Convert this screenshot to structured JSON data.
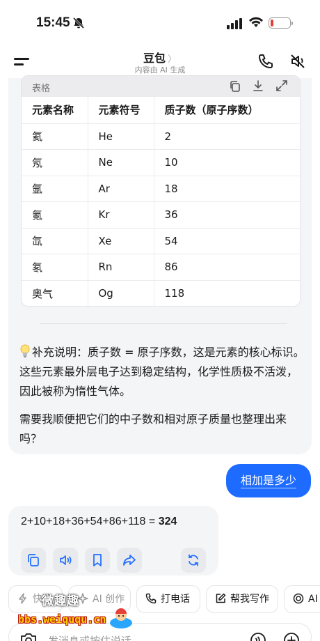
{
  "status_bar": {
    "time": "15:45"
  },
  "header": {
    "title": "豆包",
    "chevron": "〉",
    "subtitle": "内容由 AI 生成"
  },
  "table": {
    "label": "表格",
    "columns": [
      "元素名称",
      "元素符号",
      "质子数（原子序数）"
    ],
    "rows": [
      [
        "氦",
        "He",
        "2"
      ],
      [
        "氖",
        "Ne",
        "10"
      ],
      [
        "氩",
        "Ar",
        "18"
      ],
      [
        "氪",
        "Kr",
        "36"
      ],
      [
        "氙",
        "Xe",
        "54"
      ],
      [
        "氡",
        "Rn",
        "86"
      ],
      [
        "奥气",
        "Og",
        "118"
      ]
    ]
  },
  "note": "补充说明：质子数 = 原子序数，这是元素的核心标识。这些元素最外层电子达到稳定结构，化学性质极不活泼，因此被称为惰性气体。",
  "followup": "需要我顺便把它们的中子数和相对原子质量也整理出来吗？",
  "user_message": "相加是多少",
  "answer": {
    "expression": "2+10+18+36+54+86+118 = ",
    "result": "324"
  },
  "chips": [
    {
      "label": "快速",
      "icon": "lightning-icon"
    },
    {
      "label": "AI 创作",
      "icon": "sparkle-icon"
    },
    {
      "label": "打电话",
      "icon": "phone-icon"
    },
    {
      "label": "帮我写作",
      "icon": "pen-icon"
    },
    {
      "label": "AI",
      "icon": "ai-icon"
    }
  ],
  "input": {
    "placeholder": "发消息或按住说话"
  },
  "watermark": {
    "top": "微趣趣",
    "bottom": "bbs.weiququ.cn"
  },
  "colors": {
    "accent": "#1e6cff",
    "bubble": "#f4f5f7"
  }
}
